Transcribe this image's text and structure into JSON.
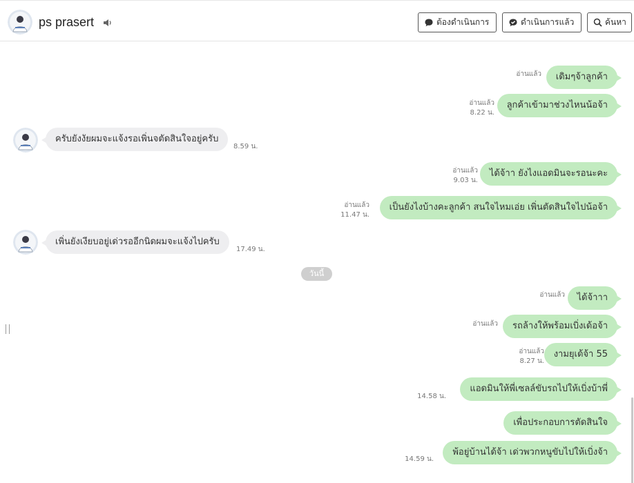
{
  "header": {
    "title": "ps prasert",
    "buttons": {
      "todo": "ต้องดำเนินการ",
      "done": "ดำเนินการแล้ว",
      "search": "ค้นหา"
    }
  },
  "icons": {
    "sound": "speaker-icon",
    "todo": "chat-bubble-icon",
    "done": "check-chat-icon",
    "search": "search-icon"
  },
  "colors": {
    "outgoing_bubble": "#c2ebc0",
    "incoming_bubble": "#eeeef0",
    "date_pill": "#cfcfcf"
  },
  "date_divider": "วันนี้",
  "messages": [
    {
      "dir": "out",
      "text": "เดิมๆจ้าลูกค้า",
      "read": "อ่านแล้ว",
      "time": ""
    },
    {
      "dir": "out",
      "text": "ลูกค้าเข้ามาช่วงไหนน้อจ้า",
      "read": "อ่านแล้ว",
      "time": "8.22 น."
    },
    {
      "dir": "in",
      "text": "ครับยังงัยผมจะแจ้งรอเพิ่นจตัดสินใจอยู่ครับ",
      "read": "",
      "time": "8.59 น."
    },
    {
      "dir": "out",
      "text": "ได้จ้าา ยังไงแอดมินจะรอนะคะ",
      "read": "อ่านแล้ว",
      "time": "9.03 น."
    },
    {
      "dir": "out",
      "text": "เป็นยังไงบ้างคะลูกค้า สนใจไหมเอ่ย เพิ่นตัดสินใจไปน้อจ้า",
      "read": "อ่านแล้ว",
      "time": "11.47 น."
    },
    {
      "dir": "in",
      "text": "เพิ่นยังเงียบอยู่เด่วรออีกนิดผมจะแจ้งไปครับ",
      "read": "",
      "time": "17.49 น."
    },
    {
      "dir": "out",
      "text": "ได้จ้าาา",
      "read": "อ่านแล้ว",
      "time": ""
    },
    {
      "dir": "out",
      "text": "รถล้างให้พร้อมเบิ่งเด้อจ้า",
      "read": "อ่านแล้ว",
      "time": ""
    },
    {
      "dir": "out",
      "text": "งามยุเด้จ้า 55",
      "read": "อ่านแล้ว",
      "time": "8.27 น."
    },
    {
      "dir": "out",
      "text": "แอดมินให้พี่เซลล์ขับรถไปให้เบิ่งบ้าพี่",
      "read": "",
      "time": "14.58 น."
    },
    {
      "dir": "out",
      "text": "เพื่อประกอบการตัดสินใจ",
      "read": "",
      "time": ""
    },
    {
      "dir": "out",
      "text": "พ้อยู่บ้านได้จ้า เด่วพวกหนูขับไปให้เบิ่งจ้า",
      "read": "",
      "time": "14.59 น."
    }
  ]
}
